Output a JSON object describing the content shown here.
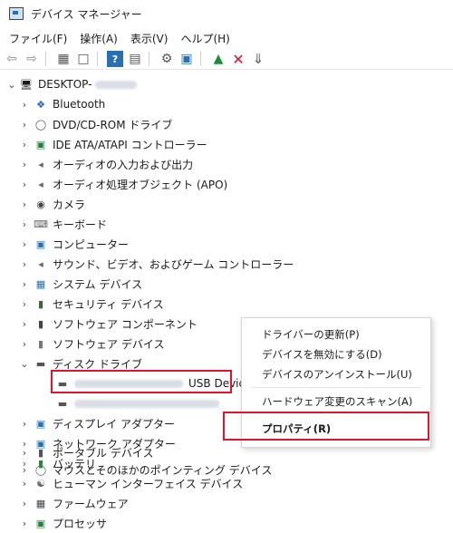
{
  "window": {
    "title": "デバイス マネージャー"
  },
  "menu": [
    "ファイル(F)",
    "操作(A)",
    "表示(V)",
    "ヘルプ(H)"
  ],
  "toolbar": {
    "icons": [
      "back-icon",
      "forward-icon",
      "properties-icon",
      "print-icon",
      "help-icon",
      "panel-icon",
      "scan-icon",
      "monitor-icon",
      "add-driver-icon",
      "delete-icon",
      "download-icon"
    ]
  },
  "tree": {
    "root": "DESKTOP-",
    "items": [
      {
        "label": "Bluetooth",
        "icon": "bluetooth-icon"
      },
      {
        "label": "DVD/CD-ROM ドライブ",
        "icon": "dvd-icon"
      },
      {
        "label": "IDE ATA/ATAPI コントローラー",
        "icon": "ide-icon"
      },
      {
        "label": "オーディオの入力および出力",
        "icon": "audio-icon"
      },
      {
        "label": "オーディオ処理オブジェクト (APO)",
        "icon": "apo-icon"
      },
      {
        "label": "カメラ",
        "icon": "camera-icon"
      },
      {
        "label": "キーボード",
        "icon": "keyboard-icon"
      },
      {
        "label": "コンピューター",
        "icon": "computer-icon"
      },
      {
        "label": "サウンド、ビデオ、およびゲーム コントローラー",
        "icon": "sound-icon"
      },
      {
        "label": "システム デバイス",
        "icon": "system-icon"
      },
      {
        "label": "セキュリティ デバイス",
        "icon": "security-icon"
      },
      {
        "label": "ソフトウェア コンポーネント",
        "icon": "software-component-icon"
      },
      {
        "label": "ソフトウェア デバイス",
        "icon": "software-device-icon"
      },
      {
        "label": "ディスク ドライブ",
        "icon": "disk-icon"
      }
    ],
    "disk_children": [
      {
        "label": "USB Device"
      }
    ],
    "items_after": [
      {
        "label": "ディスプレイ アダプター",
        "icon": "display-icon"
      },
      {
        "label": "ネットワーク アダプター",
        "icon": "network-icon"
      },
      {
        "label": "バッテリ",
        "icon": "battery-icon"
      },
      {
        "label": "ヒューマン インターフェイス デバイス",
        "icon": "hid-icon"
      },
      {
        "label": "ファームウェア",
        "icon": "firmware-icon"
      },
      {
        "label": "プロセッサ",
        "icon": "processor-icon"
      },
      {
        "label": "ポータブル デバイス",
        "icon": "portable-icon"
      },
      {
        "label": "マウスとそのほかのポインティング デバイス",
        "icon": "mouse-icon"
      }
    ]
  },
  "context_menu": {
    "update_driver": "ドライバーの更新(P)",
    "disable_device": "デバイスを無効にする(D)",
    "uninstall_device": "デバイスのアンインストール(U)",
    "scan_hardware": "ハードウェア変更のスキャン(A)",
    "properties": "プロパティ(R)"
  },
  "colors": {
    "highlight_red": "#e0142c"
  }
}
